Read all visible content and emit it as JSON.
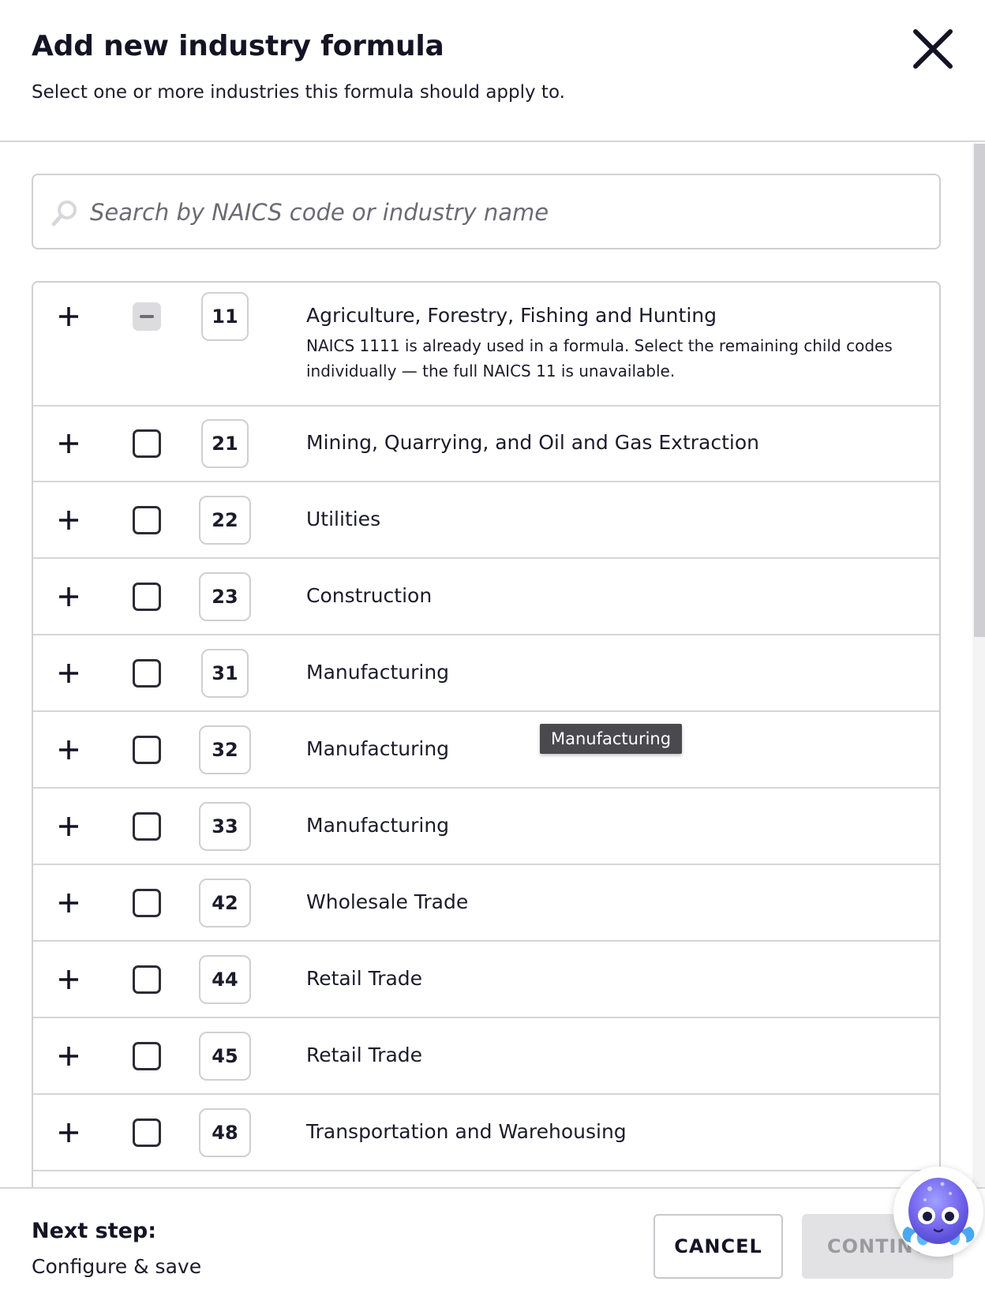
{
  "dialog": {
    "title": "Add new industry formula",
    "subtitle": "Select one or more industries this formula should apply to.",
    "close_icon": "close-icon"
  },
  "search": {
    "placeholder": "Search by NAICS code or industry name",
    "value": "",
    "icon": "search-icon"
  },
  "industries": [
    {
      "code": "11",
      "name": "Agriculture, Forestry, Fishing and Hunting",
      "checkbox": "partial",
      "note": "NAICS 1111 is already used in a formula. Select the remaining child codes individually — the full NAICS 11 is unavailable."
    },
    {
      "code": "21",
      "name": "Mining, Quarrying, and Oil and Gas Extraction",
      "checkbox": "unchecked"
    },
    {
      "code": "22",
      "name": "Utilities",
      "checkbox": "unchecked"
    },
    {
      "code": "23",
      "name": "Construction",
      "checkbox": "unchecked"
    },
    {
      "code": "31",
      "name": "Manufacturing",
      "checkbox": "unchecked"
    },
    {
      "code": "32",
      "name": "Manufacturing",
      "checkbox": "unchecked"
    },
    {
      "code": "33",
      "name": "Manufacturing",
      "checkbox": "unchecked"
    },
    {
      "code": "42",
      "name": "Wholesale Trade",
      "checkbox": "unchecked"
    },
    {
      "code": "44",
      "name": "Retail Trade",
      "checkbox": "unchecked"
    },
    {
      "code": "45",
      "name": "Retail Trade",
      "checkbox": "unchecked"
    },
    {
      "code": "48",
      "name": "Transportation and Warehousing",
      "checkbox": "unchecked"
    }
  ],
  "tooltip": {
    "text": "Manufacturing"
  },
  "footer": {
    "next_step_label": "Next step:",
    "next_step_value": "Configure & save",
    "cancel_label": "CANCEL",
    "continue_label": "CONTINUE"
  },
  "colors": {
    "text": "#1b1b2a",
    "border": "#cfcfd4",
    "disabled_bg": "#e2e2e4",
    "tooltip_bg": "#4a4a4e",
    "assistant_purple": "#7b6cf0"
  }
}
